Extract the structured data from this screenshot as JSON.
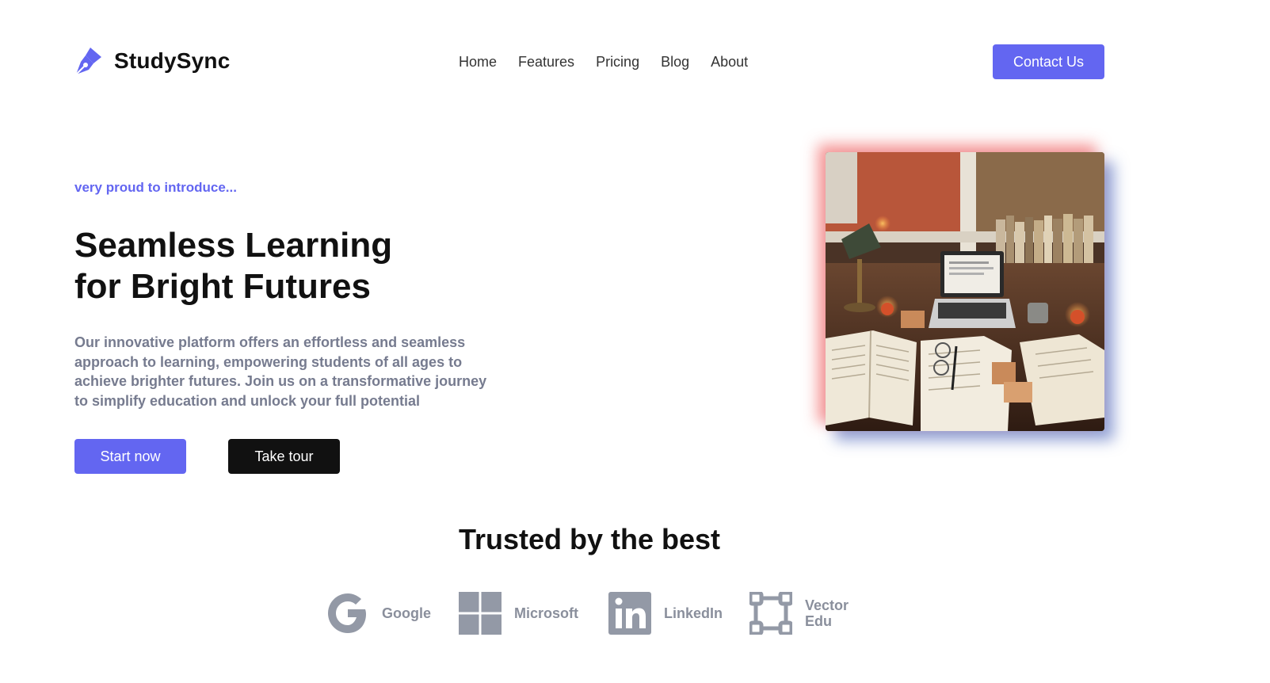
{
  "brand": {
    "name": "StudySync",
    "icon": "pen-nib-icon",
    "color": "#6366f1"
  },
  "nav": {
    "items": [
      "Home",
      "Features",
      "Pricing",
      "Blog",
      "About"
    ]
  },
  "header": {
    "contact_label": "Contact Us"
  },
  "hero": {
    "eyebrow": "very proud to introduce...",
    "title_line1": "Seamless Learning",
    "title_line2": "for Bright Futures",
    "description": "Our innovative platform offers an effortless and seamless approach to learning, empowering students of all ages to achieve brighter futures. Join us on a transformative journey to simplify education and unlock your full potential",
    "start_label": "Start now",
    "tour_label": "Take tour"
  },
  "trusted": {
    "title": "Trusted by the best",
    "logos": [
      {
        "name": "Google",
        "icon": "google-icon"
      },
      {
        "name": "Microsoft",
        "icon": "microsoft-icon"
      },
      {
        "name": "LinkedIn",
        "icon": "linkedin-icon"
      },
      {
        "name": "Vector Edu",
        "icon": "vector-frame-icon"
      }
    ]
  },
  "colors": {
    "accent": "#6366f1",
    "dark": "#111111",
    "muted": "#767b8f",
    "logo_gray": "#8a8f9c"
  }
}
